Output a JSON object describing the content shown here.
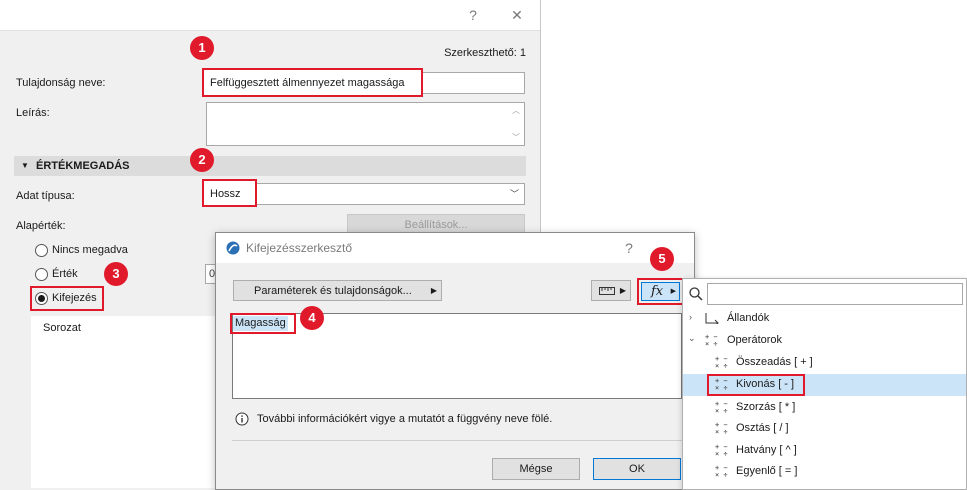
{
  "main_dialog": {
    "help_label": "?",
    "close_label": "✕",
    "editable": "Szerkeszthető: 1",
    "property_name_label": "Tulajdonság neve:",
    "property_name_value": "Felfüggesztett álmennyezet magassága",
    "description_label": "Leírás:",
    "section_title": "ÉRTÉKMEGADÁS",
    "data_type_label": "Adat típusa:",
    "data_type_value": "Hossz",
    "default_value_label": "Alapérték:",
    "settings_button": "Beállítások...",
    "radio_none": "Nincs megadva",
    "radio_value": "Érték",
    "radio_expression": "Kifejezés",
    "value_input_partial": "0",
    "series_label": "Sorozat"
  },
  "expression_editor": {
    "title": "Kifejezésszerkesztő",
    "help_label": "?",
    "params_button": "Paraméterek és tulajdonságok...",
    "expression_text": "Magasság",
    "info_text": "További információkért vigye a mutatót a függvény neve fölé.",
    "cancel_button": "Mégse",
    "ok_button": "OK",
    "fx_label": "fx"
  },
  "function_panel": {
    "search_placeholder": "",
    "items": [
      {
        "label": "Állandók",
        "type": "category",
        "expanded": false
      },
      {
        "label": "Operátorok",
        "type": "category",
        "expanded": true
      },
      {
        "label": "Összeadás  [ + ]",
        "type": "operator",
        "selected": false
      },
      {
        "label": "Kivonás [ - ]",
        "type": "operator",
        "selected": true
      },
      {
        "label": "Szorzás  [ * ]",
        "type": "operator",
        "selected": false
      },
      {
        "label": "Osztás [ / ]",
        "type": "operator",
        "selected": false
      },
      {
        "label": "Hatvány [ ^ ]",
        "type": "operator",
        "selected": false
      },
      {
        "label": "Egyenlő [ = ]",
        "type": "operator",
        "selected": false
      }
    ]
  },
  "badges": [
    "1",
    "2",
    "3",
    "4",
    "5"
  ],
  "colors": {
    "highlight": "#e0192b",
    "selection": "#cce4f7"
  }
}
